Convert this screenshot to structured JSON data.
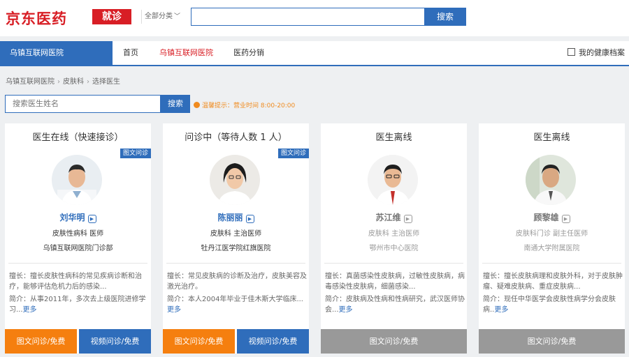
{
  "header": {
    "logo": "京东医药",
    "badge": "就诊",
    "category": "全部分类",
    "search_placeholder": "",
    "search_button": "搜索"
  },
  "nav": {
    "active": "乌镇互联网医院",
    "items": [
      "首页",
      "乌镇互联网医院",
      "医药分销"
    ],
    "health_record": "我的健康档案"
  },
  "breadcrumb": [
    "乌镇互联网医院",
    "皮肤科",
    "选择医生"
  ],
  "doctor_search": {
    "placeholder": "搜索医生姓名",
    "button": "搜索"
  },
  "notice": "温馨提示：营业时间 8:00-20:00",
  "doctors": [
    {
      "status": "医生在线（快速接诊）",
      "tag": "图文问诊",
      "name": "刘华明",
      "title": "皮肤性病科  医师",
      "hospital": "乌镇互联网医院门诊部",
      "specialty_label": "擅长：",
      "specialty": "擅长皮肤性病科的常见疾病诊断和治疗，能够评估危机力后的感染...",
      "intro_label": "简介：",
      "intro": "从事2011年，多次去上级医院进修学习...",
      "more": "更多",
      "btn_text": "图文问诊/免费",
      "btn_video": "视频问诊/免费"
    },
    {
      "status": "问诊中（等待人数 1 人）",
      "tag": "图文问诊",
      "name": "陈丽丽",
      "title": "皮肤科  主治医师",
      "hospital": "牡丹江医学院红旗医院",
      "specialty_label": "擅长：",
      "specialty": "常见皮肤病的诊断及治疗，皮肤美容及激光治疗。",
      "intro_label": "简介：",
      "intro": "本人2004年毕业于佳木斯大学临床...",
      "more": "更多",
      "btn_text": "图文问诊/免费",
      "btn_video": "视频问诊/免费"
    },
    {
      "status": "医生离线",
      "tag": "",
      "name": "苏江维",
      "title": "皮肤科  主治医师",
      "hospital": "鄂州市中心医院",
      "specialty_label": "擅长：",
      "specialty": "真菌感染性皮肤病，过敏性皮肤病，病毒感染性皮肤病，细菌感染...",
      "intro_label": "简介：",
      "intro": "皮肤病及性病和性病研究，武汉医师协会...",
      "more": "更多",
      "btn_text": "图文问诊/免费",
      "btn_video": ""
    },
    {
      "status": "医生离线",
      "tag": "",
      "name": "顾黎雄",
      "title": "皮肤科门诊  副主任医师",
      "hospital": "南通大学附属医院",
      "specialty_label": "擅长：",
      "specialty": "擅长皮肤病理和皮肤外科，对于皮肤肿瘤、疑难皮肤病、重症皮肤病...",
      "intro_label": "简介：",
      "intro": "现任中华医学会皮肤性病学分会皮肤病..",
      "more": "更多",
      "btn_text": "图文问诊/免费",
      "btn_video": ""
    }
  ],
  "colors": {
    "brand_red": "#d81e25",
    "primary_blue": "#2f6dbb",
    "orange": "#f57f0f",
    "offline_gray": "#999999"
  }
}
